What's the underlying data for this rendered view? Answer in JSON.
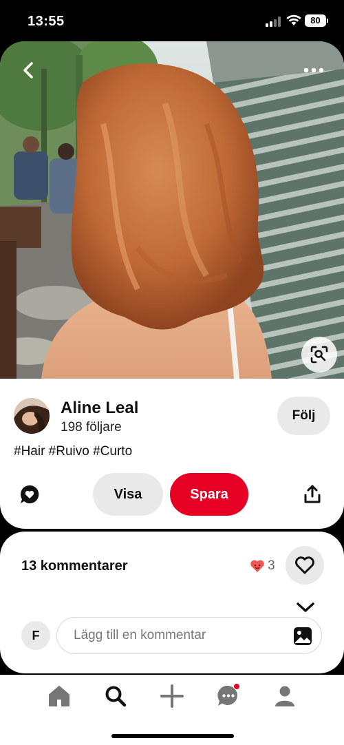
{
  "status_bar": {
    "time": "13:55",
    "battery": "80",
    "icons": [
      "signal-icon",
      "wifi-icon",
      "battery-icon"
    ]
  },
  "pin": {
    "image_description_icon": "photo",
    "actions": {
      "back_icon": "chevron-left-icon",
      "more_icon": "more-dots-icon",
      "lens_icon": "visual-search-icon"
    },
    "creator": {
      "name": "Aline Leal",
      "followers": "198 följare",
      "follow_label": "Följ"
    },
    "hashtags": "#Hair #Ruivo #Curto",
    "buttons": {
      "visa": "Visa",
      "spara": "Spara"
    }
  },
  "comments": {
    "count_label": "13 kommentarer",
    "reaction_count": "3",
    "commenter_initial": "F",
    "input_placeholder": "Lägg till en kommentar"
  },
  "nav": {
    "items": [
      "home-icon",
      "search-icon",
      "create-icon",
      "messages-icon",
      "profile-icon"
    ]
  },
  "colors": {
    "brand_red": "#e60023",
    "button_grey": "#e9e9e9"
  }
}
